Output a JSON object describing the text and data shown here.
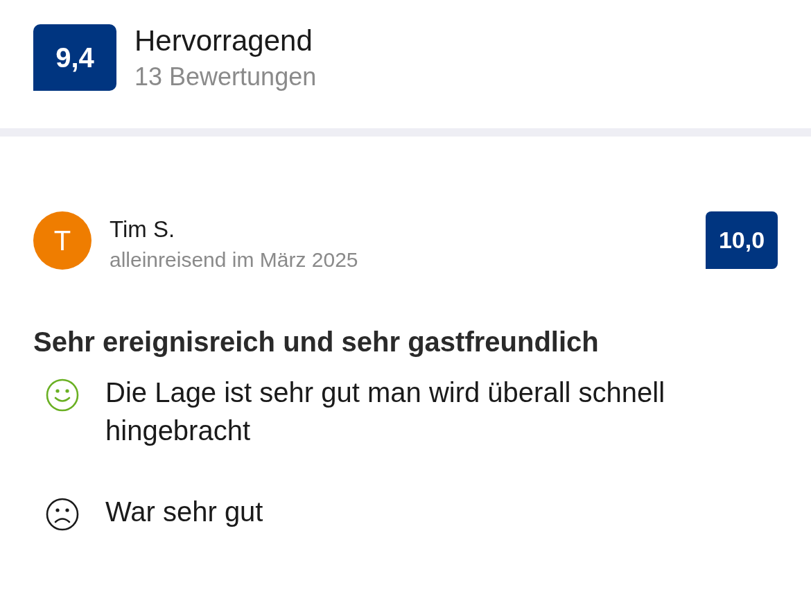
{
  "summary": {
    "score": "9,4",
    "label": "Hervorragend",
    "count": "13 Bewertungen"
  },
  "review": {
    "initial": "T",
    "author": "Tim S.",
    "subtitle": "alleinreisend im März 2025",
    "score": "10,0",
    "title": "Sehr ereignisreich und sehr gastfreundlich",
    "comments": [
      {
        "kind": "positive",
        "text": "Die Lage ist sehr gut man wird überall schnell hingebracht"
      },
      {
        "kind": "negative",
        "text": "War sehr gut"
      }
    ]
  }
}
